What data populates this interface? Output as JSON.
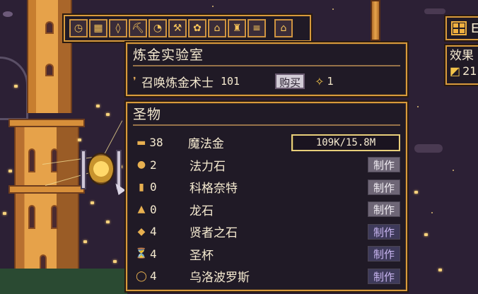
{
  "toolbar": {
    "icons": [
      {
        "name": "clock-icon",
        "glyph": "◷"
      },
      {
        "name": "building-icon",
        "glyph": "▦"
      },
      {
        "name": "coin-icon",
        "glyph": "◊"
      },
      {
        "name": "pickaxe-icon",
        "glyph": "⛏"
      },
      {
        "name": "pie-icon",
        "glyph": "◔"
      },
      {
        "name": "hammer-icon",
        "glyph": "⚒"
      },
      {
        "name": "flower-icon",
        "glyph": "✿"
      },
      {
        "name": "temple-icon",
        "glyph": "⌂"
      },
      {
        "name": "potion-icon",
        "glyph": "♜"
      },
      {
        "name": "scroll-icon",
        "glyph": "≡"
      },
      {
        "name": "home-icon",
        "glyph": "⌂"
      }
    ]
  },
  "top_right": {
    "button_label": "E",
    "effects_label": "效果",
    "effects_value": "21"
  },
  "lab": {
    "title": "炼金实验室",
    "summon_label": "召唤炼金术士",
    "summon_count": "101",
    "buy_label": "购买",
    "cost_value": "1",
    "cost_icon": "star-icon"
  },
  "relics": {
    "title": "圣物",
    "items": [
      {
        "icon": "gold-bar-icon",
        "glyph": "▬",
        "count": "38",
        "name": "魔法金",
        "progress_text": "109K/15.8M",
        "progress": 0.007
      },
      {
        "icon": "mana-stone-icon",
        "glyph": "●",
        "count": "2",
        "name": "法力石",
        "action": "制作",
        "style": "gray"
      },
      {
        "icon": "cologne-icon",
        "glyph": "▮",
        "count": "0",
        "name": "科格奈特",
        "action": "制作",
        "style": "gray"
      },
      {
        "icon": "dragon-stone-icon",
        "glyph": "▲",
        "count": "0",
        "name": "龙石",
        "action": "制作",
        "style": "gray"
      },
      {
        "icon": "sage-stone-icon",
        "glyph": "◆",
        "count": "4",
        "name": "贤者之石",
        "action": "制作",
        "style": "purple"
      },
      {
        "icon": "grail-icon",
        "glyph": "⏳",
        "count": "4",
        "name": "圣杯",
        "action": "制作",
        "style": "purple"
      },
      {
        "icon": "ouroboros-icon",
        "glyph": "◯",
        "count": "4",
        "name": "乌洛波罗斯",
        "action": "制作",
        "style": "purple"
      }
    ]
  },
  "colors": {
    "panel_border": "#d89a3c",
    "panel_bg": "#201a26",
    "make_gray": "#6e6676",
    "make_purple": "#3e3a5a"
  }
}
